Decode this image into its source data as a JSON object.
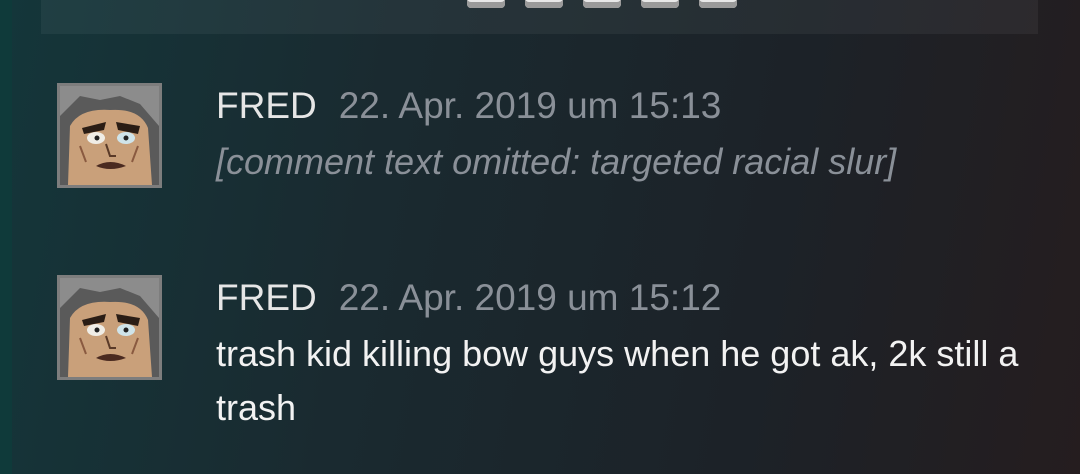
{
  "comments": [
    {
      "author": "FRED",
      "timestamp": "22. Apr. 2019 um 15:13",
      "text": "[comment text omitted: targeted racial slur]",
      "avatar_icon": "cartoon-face-avatar"
    },
    {
      "author": "FRED",
      "timestamp": "22. Apr. 2019 um 15:12",
      "text": "trash kid killing bow guys when he got ak, 2k still a trash",
      "avatar_icon": "cartoon-face-avatar"
    }
  ],
  "colors": {
    "author": "#e6e6e6",
    "timestamp": "#8a9098",
    "text": "#f2f2f2"
  }
}
